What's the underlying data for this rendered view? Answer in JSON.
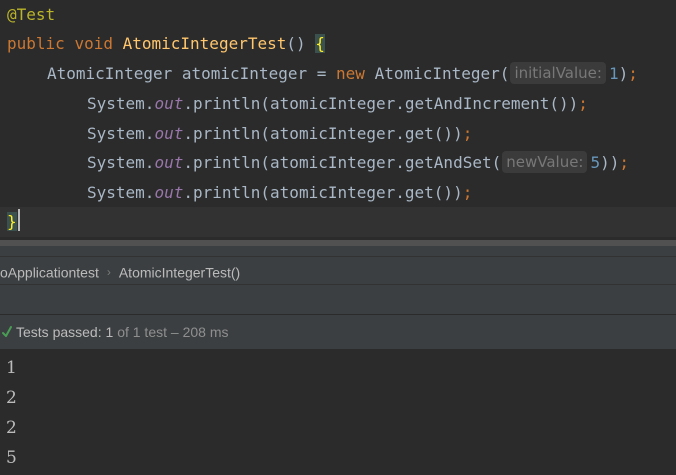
{
  "editor": {
    "line1": {
      "annotation": "@Test"
    },
    "line2": {
      "kw_public": "public",
      "kw_void": "void",
      "method_name": "AtomicIntegerTest",
      "parens": "()",
      "open_brace": "{"
    },
    "line3": {
      "type": "AtomicInteger",
      "var": "atomicInteger",
      "eq": "=",
      "kw_new": "new",
      "ctor": "AtomicInteger(",
      "hint": "initialValue:",
      "value": "1",
      "close": ")",
      "semi": ";"
    },
    "line4": {
      "system": "System.",
      "out": "out",
      "rest": ".println(atomicInteger.getAndIncrement())",
      "semi": ";"
    },
    "line5": {
      "system": "System.",
      "out": "out",
      "rest": ".println(atomicInteger.get())",
      "semi": ";"
    },
    "line6": {
      "system": "System.",
      "out": "out",
      "rest_a": ".println(atomicInteger.getAndSet(",
      "hint": "newValue:",
      "value": "5",
      "rest_b": "))",
      "semi": ";"
    },
    "line7": {
      "system": "System.",
      "out": "out",
      "rest": ".println(atomicInteger.get())",
      "semi": ";"
    },
    "line8": {
      "close_brace": "}"
    }
  },
  "breadcrumb": {
    "items": [
      "oApplicationtest",
      "AtomicIntegerTest()"
    ],
    "separator": "›"
  },
  "run_status": {
    "label": "Tests passed:",
    "passed": "1",
    "of_text": "of 1 test",
    "duration": "– 208 ms",
    "icon": "check-icon",
    "icon_color": "#499c54"
  },
  "console": {
    "lines": [
      "1",
      "2",
      "2",
      "5"
    ]
  }
}
